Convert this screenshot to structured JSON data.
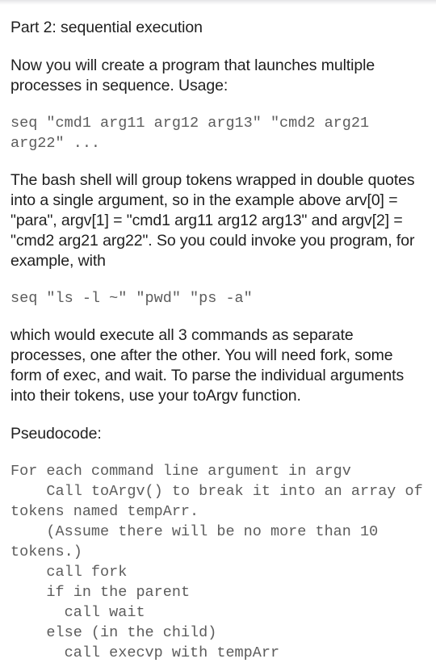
{
  "document": {
    "blocks": [
      {
        "id": "heading",
        "kind": "paragraph",
        "text": "Part 2: sequential execution"
      },
      {
        "id": "intro",
        "kind": "paragraph",
        "text": "Now you will create a program that launches multiple processes in sequence. Usage:"
      },
      {
        "id": "usage-code",
        "kind": "code",
        "text": "seq \"cmd1 arg11 arg12 arg13\" \"cmd2 arg21 arg22\" ..."
      },
      {
        "id": "explanation",
        "kind": "paragraph",
        "text": "The bash shell will group tokens wrapped in double quotes into a single argument, so in the example above arv[0] = \"para\", argv[1] = \"cmd1 arg11 arg12 arg13\" and argv[2] = \"cmd2 arg21 arg22\". So you could invoke you program, for example, with"
      },
      {
        "id": "example-code",
        "kind": "code",
        "text": "seq \"ls -l ~\" \"pwd\" \"ps -a\""
      },
      {
        "id": "description",
        "kind": "paragraph",
        "text": "which would execute all 3 commands as separate processes, one after the other. You will need fork, some form of exec, and wait. To parse the individual arguments into their tokens, use your toArgv function."
      },
      {
        "id": "pseudocode-label",
        "kind": "paragraph",
        "text": "Pseudocode:"
      },
      {
        "id": "pseudocode-block",
        "kind": "code",
        "text": "For each command line argument in argv\n    Call toArgv() to break it into an array of tokens named tempArr.\n    (Assume there will be no more than 10 tokens.)\n    call fork\n    if in the parent\n      call wait\n    else (in the child)\n      call execvp with tempArr"
      }
    ]
  }
}
